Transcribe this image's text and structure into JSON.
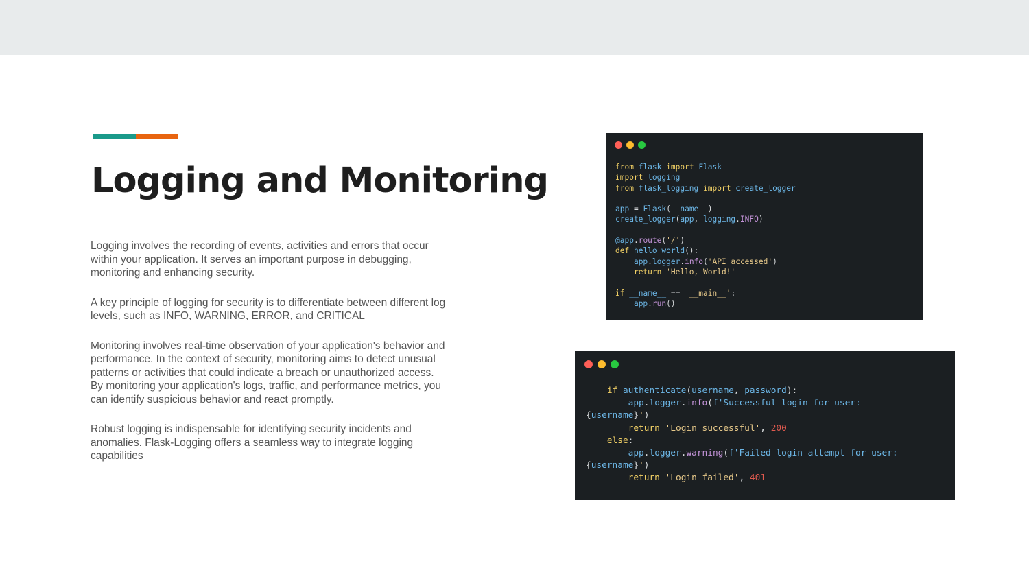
{
  "slide": {
    "title": "Logging and Monitoring",
    "paragraphs": [
      "Logging involves the recording of events, activities and errors that occur within your application.  It serves an important purpose in debugging, monitoring and enhancing security.",
      "A key principle of logging for security is to differentiate between different log levels, such as INFO, WARNING, ERROR, and CRITICAL",
      "Monitoring involves real-time observation of your application's behavior and performance. In the context of security, monitoring aims to detect unusual patterns or activities that could indicate a breach or unauthorized access. By monitoring your application's logs, traffic, and performance metrics, you can identify suspicious behavior and react promptly.",
      "Robust logging is indispensable for identifying security incidents and anomalies. Flask-Logging offers a seamless way to integrate logging capabilities"
    ],
    "accent_colors": [
      "#1a9a8a",
      "#e8640f"
    ]
  },
  "code_windows": {
    "top": {
      "lines": [
        [
          [
            "kw",
            "from"
          ],
          [
            "pl",
            " "
          ],
          [
            "fn",
            "flask"
          ],
          [
            "pl",
            " "
          ],
          [
            "kw",
            "import"
          ],
          [
            "pl",
            " "
          ],
          [
            "fn",
            "Flask"
          ]
        ],
        [
          [
            "kw",
            "import"
          ],
          [
            "pl",
            " "
          ],
          [
            "fn",
            "logging"
          ]
        ],
        [
          [
            "kw",
            "from"
          ],
          [
            "pl",
            " "
          ],
          [
            "fn",
            "flask_logging"
          ],
          [
            "pl",
            " "
          ],
          [
            "kw",
            "import"
          ],
          [
            "pl",
            " "
          ],
          [
            "fn",
            "create_logger"
          ]
        ],
        [],
        [
          [
            "fn",
            "app"
          ],
          [
            "pl",
            " = "
          ],
          [
            "fn",
            "Flask"
          ],
          [
            "pl",
            "("
          ],
          [
            "fn",
            "__name__"
          ],
          [
            "pl",
            ")"
          ]
        ],
        [
          [
            "fn",
            "create_logger"
          ],
          [
            "pl",
            "("
          ],
          [
            "fn",
            "app"
          ],
          [
            "pl",
            ", "
          ],
          [
            "fn",
            "logging"
          ],
          [
            "pl",
            "."
          ],
          [
            "attr",
            "INFO"
          ],
          [
            "pl",
            ")"
          ]
        ],
        [],
        [
          [
            "fn",
            "@app"
          ],
          [
            "pl",
            "."
          ],
          [
            "attr",
            "route"
          ],
          [
            "pl",
            "("
          ],
          [
            "str",
            "'/'"
          ],
          [
            "pl",
            ")"
          ]
        ],
        [
          [
            "kw",
            "def"
          ],
          [
            "pl",
            " "
          ],
          [
            "fn",
            "hello_world"
          ],
          [
            "pl",
            "():"
          ]
        ],
        [
          [
            "pl",
            "    "
          ],
          [
            "fn",
            "app"
          ],
          [
            "pl",
            "."
          ],
          [
            "fn",
            "logger"
          ],
          [
            "pl",
            "."
          ],
          [
            "attr",
            "info"
          ],
          [
            "pl",
            "("
          ],
          [
            "str",
            "'API accessed'"
          ],
          [
            "pl",
            ")"
          ]
        ],
        [
          [
            "pl",
            "    "
          ],
          [
            "kw",
            "return"
          ],
          [
            "pl",
            " "
          ],
          [
            "str",
            "'Hello, World!'"
          ]
        ],
        [],
        [
          [
            "kw",
            "if"
          ],
          [
            "pl",
            " "
          ],
          [
            "fn",
            "__name__"
          ],
          [
            "pl",
            " == "
          ],
          [
            "str",
            "'__main__'"
          ],
          [
            "pl",
            ":"
          ]
        ],
        [
          [
            "pl",
            "    "
          ],
          [
            "fn",
            "app"
          ],
          [
            "pl",
            "."
          ],
          [
            "attr",
            "run"
          ],
          [
            "pl",
            "()"
          ]
        ]
      ]
    },
    "bottom": {
      "lines": [
        [
          [
            "pl",
            "    "
          ],
          [
            "kw",
            "if"
          ],
          [
            "pl",
            " "
          ],
          [
            "fn",
            "authenticate"
          ],
          [
            "pl",
            "("
          ],
          [
            "fn",
            "username"
          ],
          [
            "pl",
            ", "
          ],
          [
            "fn",
            "password"
          ],
          [
            "pl",
            "):"
          ]
        ],
        [
          [
            "pl",
            "        "
          ],
          [
            "fn",
            "app"
          ],
          [
            "pl",
            "."
          ],
          [
            "fn",
            "logger"
          ],
          [
            "pl",
            "."
          ],
          [
            "attr",
            "info"
          ],
          [
            "pl",
            "("
          ],
          [
            "fn",
            "f'Successful login for user:"
          ]
        ],
        [
          [
            "pl",
            "{"
          ],
          [
            "fn",
            "username"
          ],
          [
            "pl",
            "}"
          ],
          [
            "str",
            "'"
          ],
          [
            "pl",
            ")"
          ]
        ],
        [
          [
            "pl",
            "        "
          ],
          [
            "kw",
            "return"
          ],
          [
            "pl",
            " "
          ],
          [
            "str",
            "'Login successful'"
          ],
          [
            "pl",
            ", "
          ],
          [
            "num",
            "200"
          ]
        ],
        [
          [
            "pl",
            "    "
          ],
          [
            "kw",
            "else"
          ],
          [
            "pl",
            ":"
          ]
        ],
        [
          [
            "pl",
            "        "
          ],
          [
            "fn",
            "app"
          ],
          [
            "pl",
            "."
          ],
          [
            "fn",
            "logger"
          ],
          [
            "pl",
            "."
          ],
          [
            "attr",
            "warning"
          ],
          [
            "pl",
            "("
          ],
          [
            "fn",
            "f'Failed login attempt for user:"
          ]
        ],
        [
          [
            "pl",
            "{"
          ],
          [
            "fn",
            "username"
          ],
          [
            "pl",
            "}"
          ],
          [
            "str",
            "'"
          ],
          [
            "pl",
            ")"
          ]
        ],
        [
          [
            "pl",
            "        "
          ],
          [
            "kw",
            "return"
          ],
          [
            "pl",
            " "
          ],
          [
            "str",
            "'Login failed'"
          ],
          [
            "pl",
            ", "
          ],
          [
            "num",
            "401"
          ]
        ]
      ]
    }
  }
}
